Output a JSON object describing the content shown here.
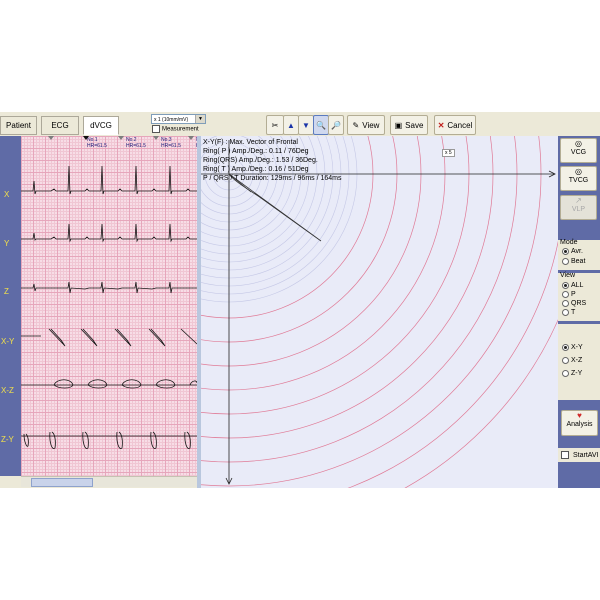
{
  "tabs": [
    {
      "label": "Patient"
    },
    {
      "label": "ECG"
    },
    {
      "label": "dVCG"
    }
  ],
  "toolbar": {
    "gain_value": "x 1 (10mm/mV)",
    "measurement_label": "Measurement",
    "view_label": "View",
    "save_label": "Save",
    "cancel_label": "Cancel"
  },
  "leads": [
    "X",
    "Y",
    "Z",
    "X-Y",
    "X-Z",
    "Z-Y"
  ],
  "beats": [
    {
      "no": "No.1",
      "hr": "HR=61.5"
    },
    {
      "no": "No.2",
      "hr": "HR=61.5"
    },
    {
      "no": "No.3",
      "hr": "HR=61.5"
    },
    {
      "no": "No",
      "hr": "HR"
    }
  ],
  "vector_info": {
    "line1": "X-Y(F) : Max. Vector of Frontal",
    "line2": "Ring( P ) Amp./Deg.: 0.11 / 76Deg",
    "line3": "Ring(QRS) Amp./Deg.: 1.53 / 36Deg.",
    "line4": "Ring( T ) Amp./Deg.: 0.16 / 51Deg",
    "line5": "P / QRS / T Duration: 129ms / 96ms / 164ms",
    "scale": "x 5"
  },
  "right_panel": {
    "vcg_label": "VCG",
    "tvcg_label": "TVCG",
    "vlp_label": "VLP",
    "mode_title": "Mode",
    "mode_options": [
      "Avr.",
      "Beat"
    ],
    "mode_selected": "Avr.",
    "view_title": "View",
    "view_options": [
      "ALL",
      "P",
      "QRS",
      "T"
    ],
    "view_selected": "ALL",
    "plane_options": [
      "X-Y",
      "X-Z",
      "Z-Y"
    ],
    "plane_selected": "X-Y",
    "analysis_label": "Analysis",
    "start_label": "StartAVI"
  },
  "colors": {
    "ecg_grid_bg": "#f7dde6",
    "lead_bar": "#5f6ba6",
    "lead_label": "#f2e04a",
    "vector_bg": "#e9ebf8",
    "arcs": "#e07a96"
  }
}
